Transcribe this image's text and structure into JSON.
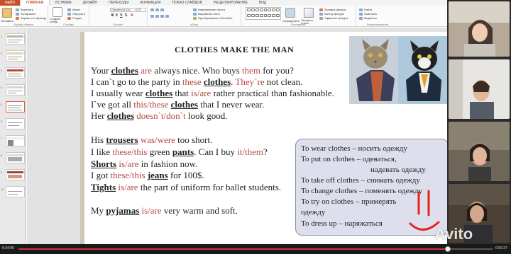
{
  "ribbon": {
    "tabs": [
      "ФАЙЛ",
      "ГЛАВНАЯ",
      "ВСТАВКА",
      "ДИЗАЙН",
      "ПЕРЕХОДЫ",
      "АНИМАЦИЯ",
      "ПОКАЗ СЛАЙДОВ",
      "РЕЦЕНЗИРОВАНИЕ",
      "ВИД"
    ],
    "active_tab": "ГЛАВНАЯ",
    "clipboard": {
      "paste": "Вставить",
      "cut": "Вырезать",
      "copy": "Копировать",
      "format": "Формат по образцу",
      "label": "Буфер обмена"
    },
    "slides": {
      "new": "Создать слайд",
      "layout": "Макет",
      "reset": "Сбросить",
      "section": "Раздел",
      "label": "Слайды"
    },
    "font": {
      "name": "Garamond (Ос",
      "size": "15",
      "label": "Шрифт"
    },
    "paragraph": {
      "direction": "Направление текста",
      "align": "Выровнять текст",
      "smartart": "Преобразовать в SmartArt",
      "label": "Абзац"
    },
    "drawing": {
      "arrange": "Упорядочить",
      "quick_styles": "Экспресс-стили",
      "fill": "Заливка фигуры",
      "outline": "Контур фигуры",
      "effects": "Эффекты фигуры",
      "label": "Рисование"
    },
    "editing": {
      "find": "Найти",
      "replace": "Заменить",
      "select": "Выделить",
      "label": "Редактирование"
    }
  },
  "thumbnails": [
    "1",
    "2",
    "3",
    "4",
    "5",
    "6",
    "7",
    "8",
    "9",
    "10"
  ],
  "slide": {
    "title": "CLOTHES  MAKE  THE  MAN",
    "sentences_a": {
      "l1": {
        "a": "Your ",
        "k": "clothes",
        "r": "are",
        "b": " always nice. Who buys ",
        "r2": "them",
        "c": " for you?"
      },
      "l2": {
        "a": "I can`t go to the party in ",
        "r": "these",
        "k": "clothes",
        "r2": "They`re",
        "c": " not clean."
      },
      "l3": {
        "a": "I usually wear ",
        "k": "clothes",
        "r": "is/are",
        "b": " that ",
        "c": " rather practical than fashionable."
      },
      "l4": {
        "a": "I`ve got all ",
        "r": "this/these",
        "k": "clothes",
        "c": " that I never wear."
      },
      "l5": {
        "a": "Her ",
        "k": "clothes",
        "r": "doesn`t/don`t",
        "c": " look good."
      }
    },
    "sentences_b": {
      "l1": {
        "a": "His ",
        "k": "trousers",
        "r": "was/were",
        "c": " too short."
      },
      "l2": {
        "a": "I like ",
        "r": "these/this",
        "b": " green ",
        "k": "pants",
        "c": ". Can I buy ",
        "r2": "it/them",
        "d": "?"
      },
      "l3": {
        "k": "Shorts",
        "r": "is/are",
        "c": " in fashion now."
      },
      "l4": {
        "a": "I got ",
        "r": "these/this",
        "k": "jeans",
        "c": " for 100$."
      },
      "l5": {
        "k": "Tights",
        "r": "is/are",
        "c": " the part of  uniform for ballet students."
      },
      "l6": {
        "a": "My ",
        "k": "pyjamas",
        "r": "is/are",
        "c": " very warm and soft."
      }
    },
    "vocab": [
      "To wear clothes – носить одежду",
      "To put on clothes – одеваться,",
      "надевать одежду",
      "To take off clothes – снимать одежду",
      "To change clothes – поменять одежду",
      "To try on clothes   – примерять",
      "одежду",
      "To dress up          – наряжаться"
    ]
  },
  "player": {
    "elapsed": "0:34:05",
    "total": "0:50:37",
    "progress": 0.905
  },
  "watermark": "Avito",
  "colors": {
    "accent": "#c6502a",
    "keyword_red": "#b5483e",
    "annotation": "#e8221b"
  }
}
